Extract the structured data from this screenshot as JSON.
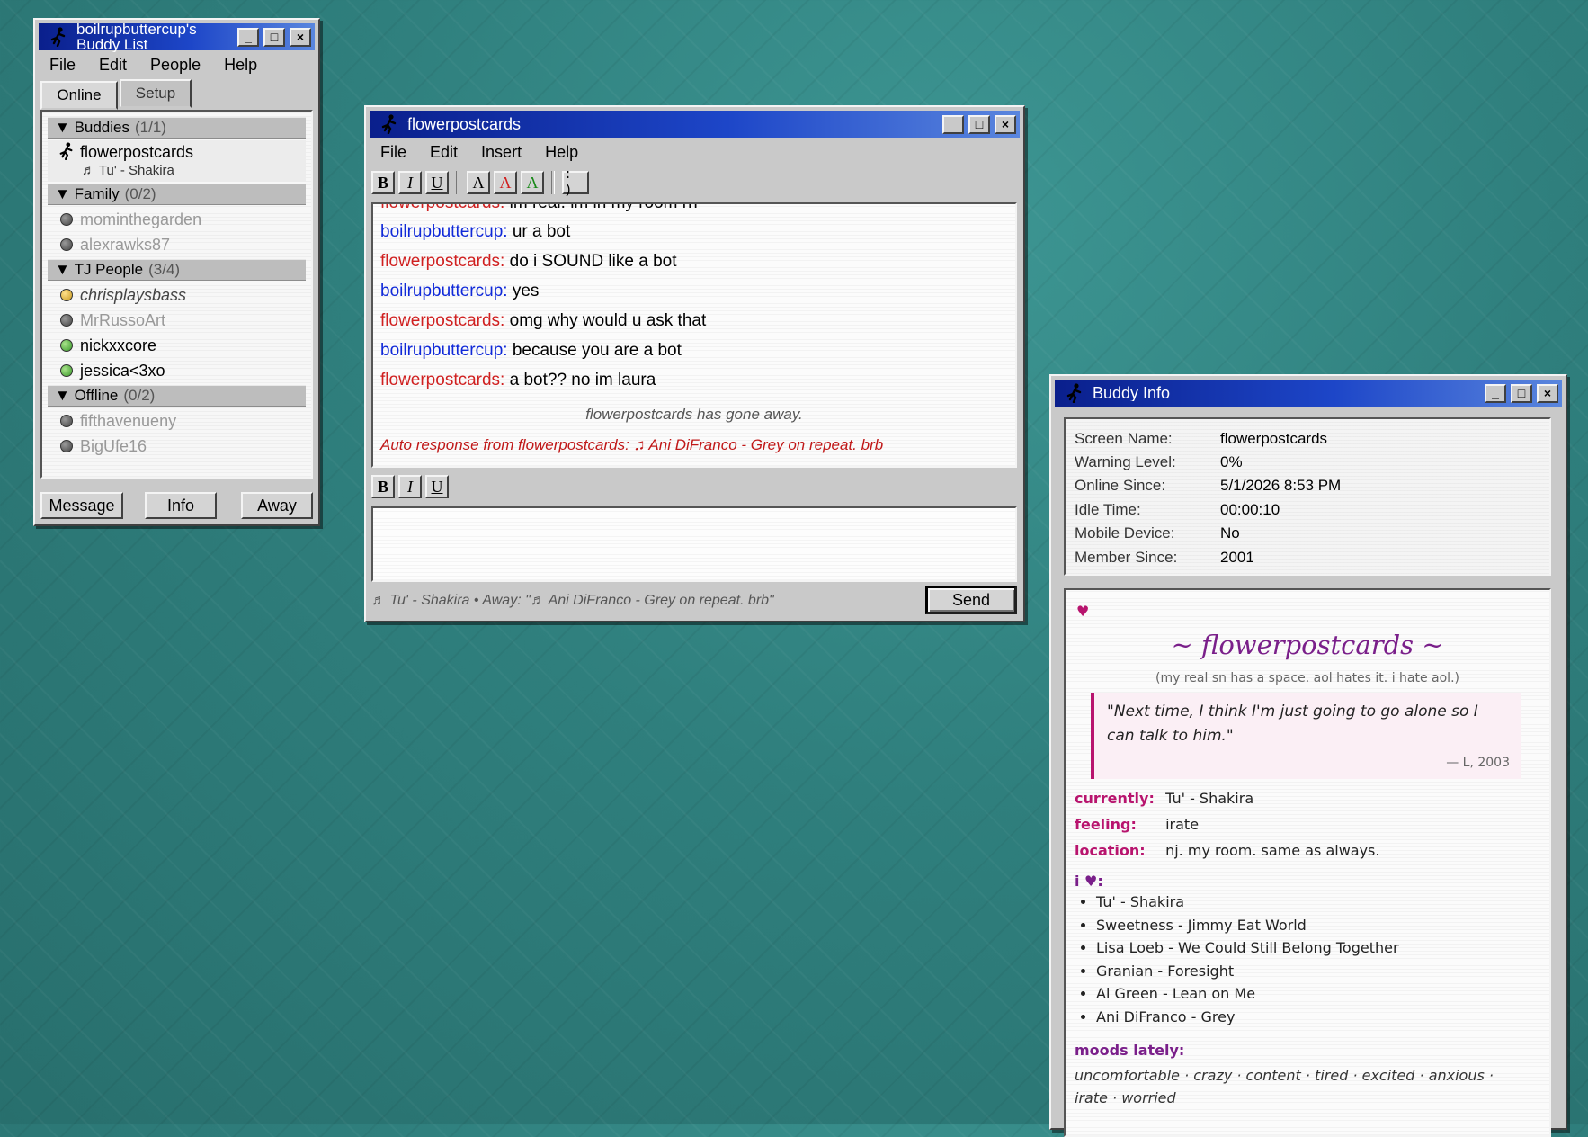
{
  "buddy_list": {
    "title": "boilrupbuttercup's Buddy List",
    "menu": [
      "File",
      "Edit",
      "People",
      "Help"
    ],
    "tabs": [
      "Online",
      "Setup"
    ],
    "groups": [
      {
        "name": "Buddies",
        "count": "(1/1)"
      },
      {
        "name": "Family",
        "count": "(0/2)"
      },
      {
        "name": "TJ People",
        "count": "(3/4)"
      },
      {
        "name": "Offline",
        "count": "(0/2)"
      }
    ],
    "selected_buddy": {
      "name": "flowerpostcards",
      "status": "♬ Tu' - Shakira"
    },
    "family": [
      "mominthegarden",
      "alexrawks87"
    ],
    "tj_people": [
      "chrisplaysbass",
      "MrRussoArt",
      "nickxxcore",
      "jessica<3xo"
    ],
    "offline": [
      "fifthavenueny",
      "BigUfe16"
    ],
    "buttons": {
      "message": "Message",
      "info": "Info",
      "away": "Away"
    }
  },
  "chat": {
    "title": "flowerpostcards",
    "menu": [
      "File",
      "Edit",
      "Insert",
      "Help"
    ],
    "format": {
      "bold": "B",
      "italic": "I",
      "underline": "U",
      "font_a": "A",
      "smiley": ": )"
    },
    "partial_line": {
      "who": "flowerpostcards:",
      "text": "im real. im in my room rn"
    },
    "messages": [
      {
        "who": "boilrupbuttercup:",
        "text": "ur a bot"
      },
      {
        "who": "flowerpostcards:",
        "text": "do i SOUND like a bot"
      },
      {
        "who": "boilrupbuttercup:",
        "text": "yes"
      },
      {
        "who": "flowerpostcards:",
        "text": "omg why would u ask that"
      },
      {
        "who": "boilrupbuttercup:",
        "text": "because you are a bot"
      },
      {
        "who": "flowerpostcards:",
        "text": "a bot?? no im laura"
      }
    ],
    "away_notice": "flowerpostcards has gone away.",
    "auto_response": "Auto response from flowerpostcards: ♫ Ani DiFranco - Grey on repeat. brb",
    "status_line": "♬ Tu' - Shakira • Away: \"♬ Ani DiFranco - Grey on repeat. brb\"",
    "send_label": "Send"
  },
  "buddy_info": {
    "title": "Buddy Info",
    "fields": [
      {
        "k": "Screen Name:",
        "v": "flowerpostcards"
      },
      {
        "k": "Warning Level:",
        "v": "0%"
      },
      {
        "k": "Online Since:",
        "v": "5/1/2026 8:53 PM"
      },
      {
        "k": "Idle Time:",
        "v": "00:00:10"
      },
      {
        "k": "Mobile Device:",
        "v": "No"
      },
      {
        "k": "Member Since:",
        "v": "2001"
      }
    ],
    "profile": {
      "heart": "♥",
      "heading": "~ flowerpostcards ~",
      "subheading": "(my real sn has a space. aol hates it. i hate aol.)",
      "quote": "\"Next time, I think I'm just going to go alone so I can talk to him.\"",
      "quote_attr": "— L, 2003",
      "currently_label": "currently:",
      "currently": "Tu' - Shakira",
      "feeling_label": "feeling:",
      "feeling": "irate",
      "location_label": "location:",
      "location": "nj. my room. same as always.",
      "loves_label": "i ♥:",
      "loves": [
        "Tu' - Shakira",
        "Sweetness - Jimmy Eat World",
        "Lisa Loeb - We Could Still Belong Together",
        "Granian - Foresight",
        "Al Green - Lean on Me",
        "Ani DiFranco - Grey"
      ],
      "moods_label": "moods lately:",
      "moods": "uncomfortable · crazy · content · tired · excited · anxious · irate · worried"
    }
  },
  "window_buttons": {
    "minimize": "_",
    "maximize": "□",
    "close": "×"
  },
  "colors": {
    "desktop": "#2f7f7d",
    "titlebar": "#0a1f8c",
    "self_name": "#1029d8",
    "buddy_name": "#d02020",
    "profile_accent": "#b8146e"
  }
}
